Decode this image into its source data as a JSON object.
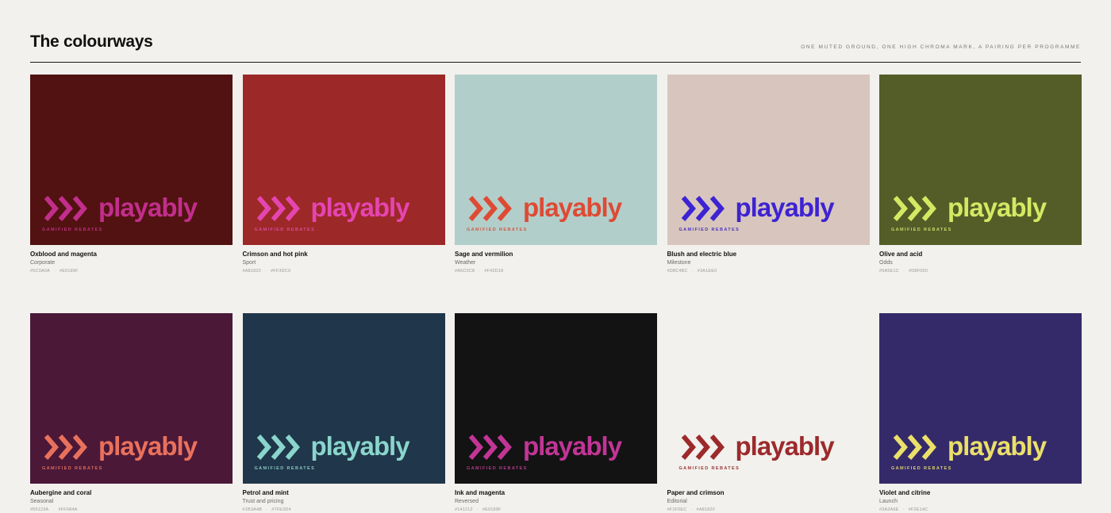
{
  "page": {
    "title": "The colourways",
    "tagline": "ONE MUTED GROUND, ONE HIGH CHROMA MARK, A PAIRING PER PROGRAMME"
  },
  "logo": {
    "wordmark": "playably",
    "subline": "GAMIFIED REBATES",
    "icon": "triple-chevron-icon"
  },
  "colourways": [
    {
      "name": "Oxblood and magenta",
      "use": "Corporate",
      "ground_hex": "#5C0A0A",
      "mark_hex": "#E0189F",
      "ground": "#521211",
      "mark": "#C22E8C",
      "sub": "#B9307F"
    },
    {
      "name": "Crimson and hot pink",
      "use": "Sport",
      "ground_hex": "#A81820",
      "mark_hex": "#FF3DC0",
      "ground": "#9C2828",
      "mark": "#E545B0",
      "sub": "#D44E9A"
    },
    {
      "name": "Sage and vermilion",
      "use": "Weather",
      "ground_hex": "#A5C0C8",
      "mark_hex": "#F42D18",
      "ground": "#B2CECA",
      "mark": "#DE4A34",
      "sub": "#D25A42"
    },
    {
      "name": "Blush and electric blue",
      "use": "Milestone",
      "ground_hex": "#D8C4BC",
      "mark_hex": "#3A1EE0",
      "ground": "#D8C6BE",
      "mark": "#3D23D2",
      "sub": "#4A34BC"
    },
    {
      "name": "Olive and acid",
      "use": "Odds",
      "ground_hex": "#5A5E1C",
      "mark_hex": "#D8F050",
      "ground": "#545D28",
      "mark": "#D4E962",
      "sub": "#C5D866"
    },
    {
      "name": "Aubergine and coral",
      "use": "Seasonal",
      "ground_hex": "#55123A",
      "mark_hex": "#FF684A",
      "ground": "#4B1838",
      "mark": "#E9715C",
      "sub": "#DB6B5A"
    },
    {
      "name": "Petrol and mint",
      "use": "Trust and pricing",
      "ground_hex": "#1B3A4B",
      "mark_hex": "#7FE3D4",
      "ground": "#20364A",
      "mark": "#8AD5CC",
      "sub": "#86C5BE"
    },
    {
      "name": "Ink and magenta",
      "use": "Reversed",
      "ground_hex": "#141212",
      "mark_hex": "#E0189F",
      "ground": "#131313",
      "mark": "#C23596",
      "sub": "#B13C8A"
    },
    {
      "name": "Paper and crimson",
      "use": "Editorial",
      "ground_hex": "#F2F0EC",
      "mark_hex": "#A81820",
      "ground": "#F2F1ED",
      "mark": "#9C2A2C",
      "sub": "#9C3538"
    },
    {
      "name": "Violet and citrine",
      "use": "Launch",
      "ground_hex": "#3A2A6E",
      "mark_hex": "#F2E14C",
      "ground": "#352A69",
      "mark": "#EAE06A",
      "sub": "#D7CE6E"
    }
  ]
}
